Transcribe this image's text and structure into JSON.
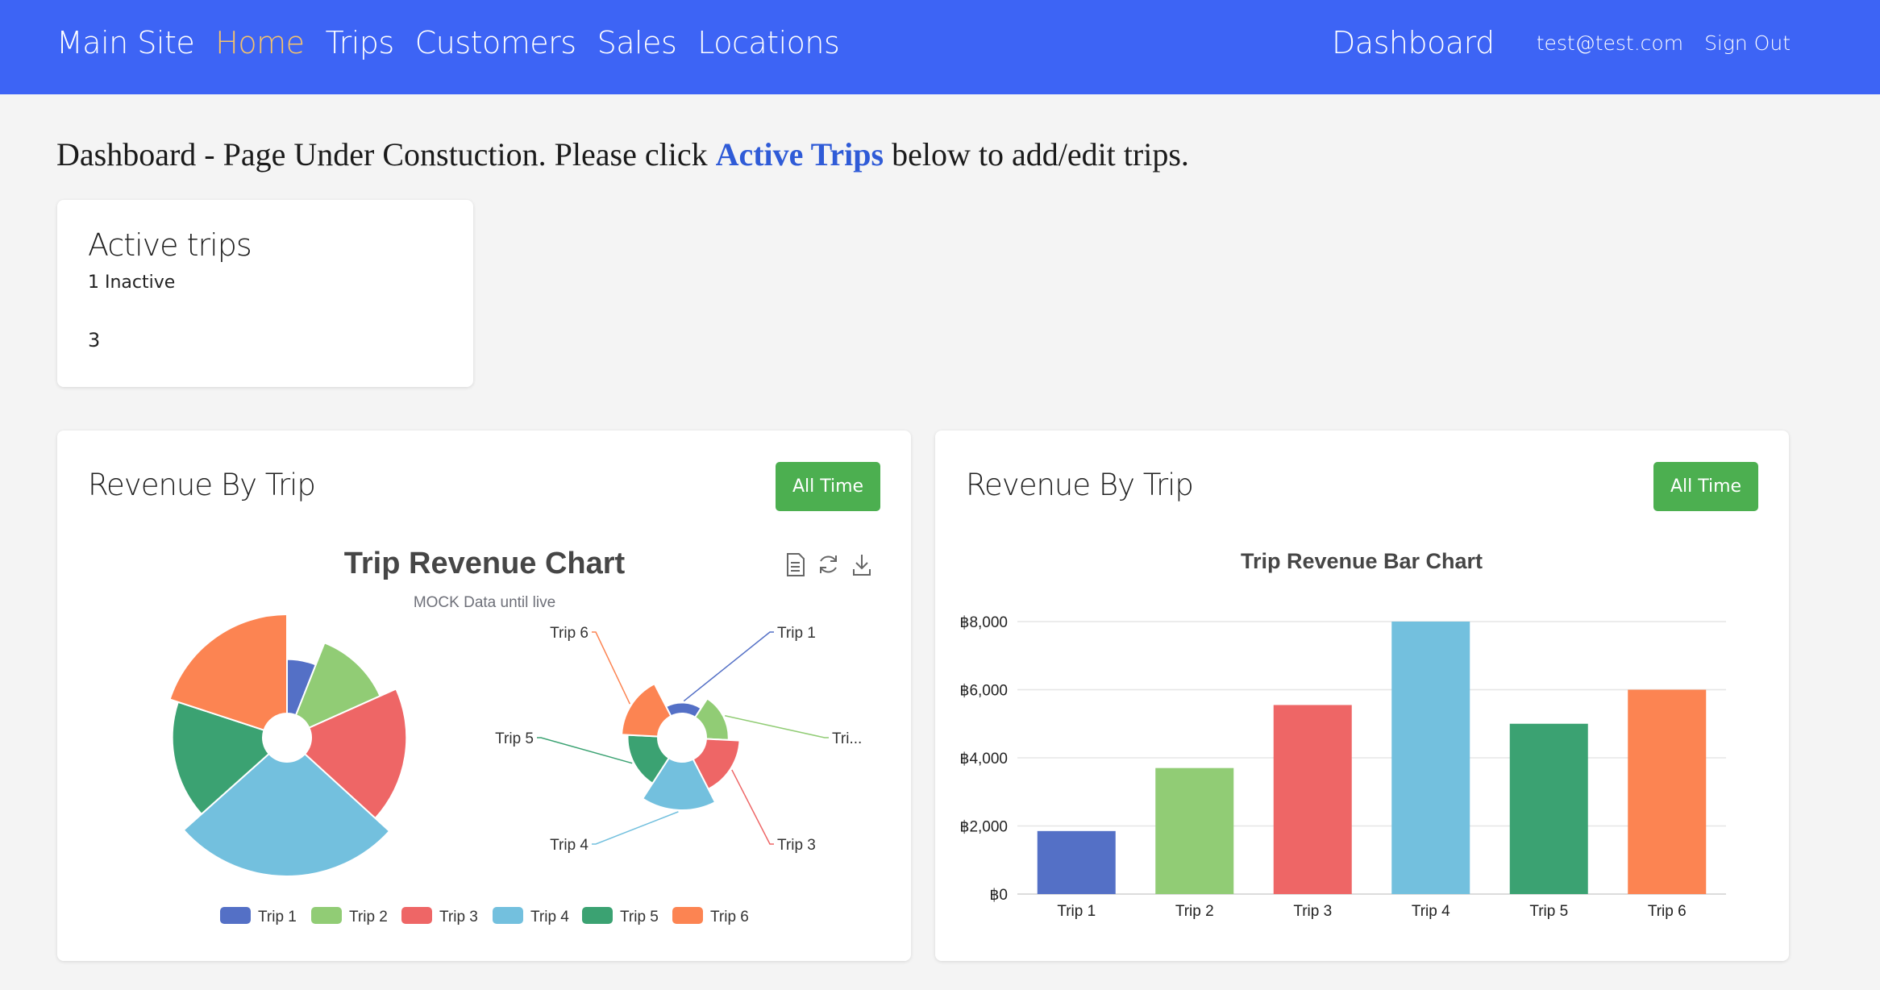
{
  "nav": {
    "items": [
      {
        "label": "Main Site",
        "active": false
      },
      {
        "label": "Home",
        "active": true
      },
      {
        "label": "Trips",
        "active": false
      },
      {
        "label": "Customers",
        "active": false
      },
      {
        "label": "Sales",
        "active": false
      },
      {
        "label": "Locations",
        "active": false
      }
    ],
    "dashboard": "Dashboard",
    "email": "test@test.com",
    "signout": "Sign Out"
  },
  "heading": {
    "before": "Dashboard - Page Under Constuction. Please click ",
    "link": "Active Trips",
    "after": " below to add/edit trips."
  },
  "active_card": {
    "title": "Active trips",
    "subtitle": "1 Inactive",
    "count": "3"
  },
  "pie_card": {
    "title": "Revenue By Trip",
    "button": "All Time"
  },
  "bar_card": {
    "title": "Revenue By Trip",
    "button": "All Time"
  },
  "chart_data": [
    {
      "type": "pie",
      "title": "Trip Revenue Chart",
      "subtitle": "MOCK Data until live",
      "variant": "rose (two nightingale charts: radius and area)",
      "categories": [
        "Trip 1",
        "Trip 2",
        "Trip 3",
        "Trip 4",
        "Trip 5",
        "Trip 6"
      ],
      "values": [
        1800,
        3700,
        5550,
        8000,
        5000,
        6000
      ],
      "labels_shown": [
        "Trip 1",
        "Tri...",
        "Trip 3",
        "Trip 4",
        "Trip 5",
        "Trip 6"
      ],
      "colors": [
        "#5470c6",
        "#91cc75",
        "#ee6666",
        "#73c0de",
        "#3ba272",
        "#fc8452"
      ],
      "legend": "bottom",
      "toolbox_icons": [
        "data-view-icon",
        "restore-icon",
        "download-icon"
      ]
    },
    {
      "type": "bar",
      "title": "Trip Revenue Bar Chart",
      "categories": [
        "Trip 1",
        "Trip 2",
        "Trip 3",
        "Trip 4",
        "Trip 5",
        "Trip 6"
      ],
      "values": [
        1850,
        3700,
        5550,
        8000,
        5000,
        6000
      ],
      "colors": [
        "#5470c6",
        "#91cc75",
        "#ee6666",
        "#73c0de",
        "#3ba272",
        "#fc8452"
      ],
      "yticks": [
        "฿0",
        "฿2,000",
        "฿4,000",
        "฿6,000",
        "฿8,000"
      ],
      "ylim": [
        0,
        8000
      ],
      "grid": true
    }
  ]
}
